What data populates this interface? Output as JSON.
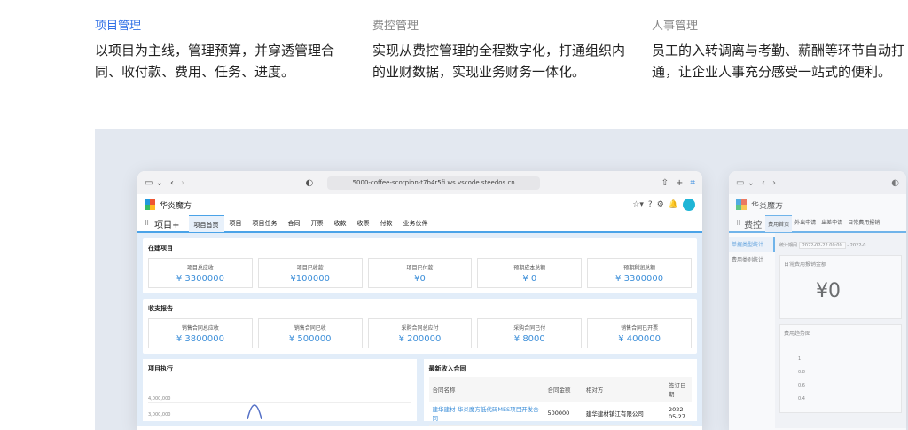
{
  "features": [
    {
      "title": "项目管理",
      "desc": "以项目为主线，管理预算，并穿透管理合同、收付款、费用、任务、进度。",
      "active": true
    },
    {
      "title": "费控管理",
      "desc": "实现从费控管理的全程数字化，打通组织内的业财数据，实现业务财务一体化。",
      "active": false
    },
    {
      "title": "人事管理",
      "desc": "员工的入转调离与考勤、薪酬等环节自动打通，让企业人事充分感受一站式的便利。",
      "active": false
    }
  ],
  "win1": {
    "url": "5000-coffee-scorpion-t7b4r5fi.ws.vscode.steedos.cn",
    "brand": "华炎魔方",
    "app": "项目+",
    "tabs": [
      "项目首页",
      "项目",
      "项目任务",
      "合同",
      "开票",
      "收款",
      "收票",
      "付款",
      "业务伙伴"
    ],
    "section1": {
      "title": "在建项目",
      "kpis": [
        {
          "label": "项目总应收",
          "value": "¥ 3300000"
        },
        {
          "label": "项目已收款",
          "value": "¥100000"
        },
        {
          "label": "项目已付款",
          "value": "¥0"
        },
        {
          "label": "预期成本总额",
          "value": "¥ 0"
        },
        {
          "label": "预期利润总额",
          "value": "¥ 3300000"
        }
      ]
    },
    "section2": {
      "title": "收支报告",
      "kpis": [
        {
          "label": "销售合同总应收",
          "value": "¥ 3800000"
        },
        {
          "label": "销售合同已收",
          "value": "¥ 500000"
        },
        {
          "label": "采购合同总应付",
          "value": "¥ 200000"
        },
        {
          "label": "采购合同已付",
          "value": "¥ 8000"
        },
        {
          "label": "销售合同已开票",
          "value": "¥ 400000"
        }
      ]
    },
    "exec": {
      "title": "项目执行",
      "ticks": [
        "4,000,000",
        "3,000,000"
      ]
    },
    "contracts": {
      "title": "最新收入合同",
      "headers": [
        "合同名称",
        "合同金额",
        "相对方",
        "签订日期"
      ],
      "rows": [
        [
          "建华建材-华炎魔方低代码MES项目开发合同",
          "500000",
          "建华建材镇江有限公司",
          "2022-05-27"
        ]
      ]
    }
  },
  "win2": {
    "brand": "华炎魔方",
    "app": "费控",
    "tabs": [
      "费用首页",
      "外出申请",
      "出差申请",
      "日常费用报销"
    ],
    "side": [
      "单据类型统计",
      "费用类别统计"
    ],
    "period_label": "统计期间",
    "period_start": "2022-02-22 00:00",
    "period_end": "- 2022-0",
    "amount_title": "日常费用报销金额",
    "amount": "¥0",
    "trend_title": "费用趋势图",
    "ticks": [
      "1",
      "0.8",
      "0.6",
      "0.4"
    ]
  }
}
